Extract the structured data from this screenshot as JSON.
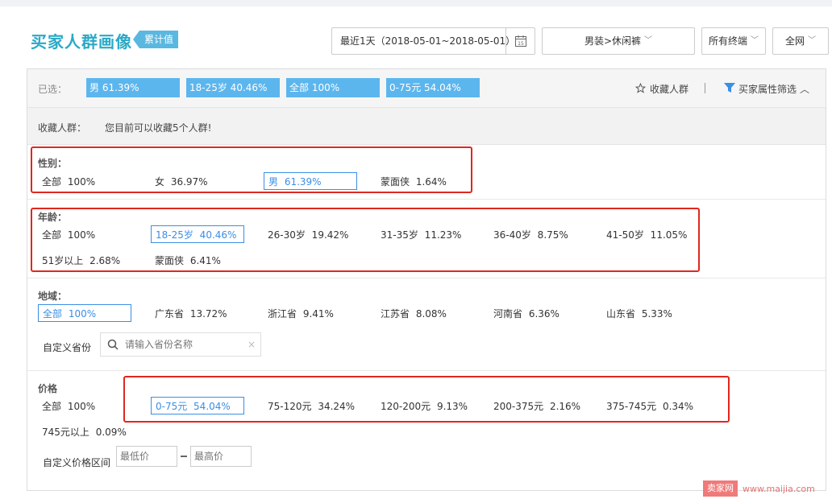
{
  "header": {
    "title": "买家人群画像",
    "badge": "累计值",
    "date_range": "最近1天（2018-05-01~2018-05-01）",
    "calendar_day": "15",
    "category": "男装>休闲裤",
    "terminal": "所有终端",
    "network": "全网"
  },
  "selected": {
    "label": "已选：",
    "chips": [
      "男 61.39%",
      "18-25岁 40.46%",
      "全部 100%",
      "0-75元 54.04%"
    ],
    "fav_link": "收藏人群",
    "filter_link": "买家属性筛选"
  },
  "favorites": {
    "label": "收藏人群：",
    "note": "您目前可以收藏5个人群!"
  },
  "gender": {
    "title": "性别：",
    "options": [
      "全部 100%",
      "女 36.97%",
      "男 61.39%",
      "蒙面侠 1.64%"
    ]
  },
  "age": {
    "title": "年龄：",
    "options": [
      "全部 100%",
      "18-25岁 40.46%",
      "26-30岁 19.42%",
      "31-35岁 11.23%",
      "36-40岁 8.75%",
      "41-50岁 11.05%",
      "51岁以上 2.68%",
      "蒙面侠 6.41%"
    ]
  },
  "region": {
    "title": "地域：",
    "options": [
      "全部 100%",
      "广东省 13.72%",
      "浙江省 9.41%",
      "江苏省 8.08%",
      "河南省 6.36%",
      "山东省 5.33%"
    ],
    "custom_label": "自定义省份",
    "search_placeholder": "请输入省份名称"
  },
  "price": {
    "title": "价格",
    "options": [
      "全部 100%",
      "0-75元 54.04%",
      "75-120元 34.24%",
      "120-200元 9.13%",
      "200-375元 2.16%",
      "375-745元 0.34%",
      "745元以上 0.09%"
    ],
    "custom_label": "自定义价格区间",
    "min_placeholder": "最低价",
    "max_placeholder": "最高价"
  },
  "watermark": {
    "logo": "卖家网",
    "url": "www.maijia.com"
  },
  "colors": {
    "brand": "#2aa9c7",
    "chip": "#5cb6ee",
    "selected_border": "#3a8ee6",
    "highlight": "#e0271f"
  }
}
